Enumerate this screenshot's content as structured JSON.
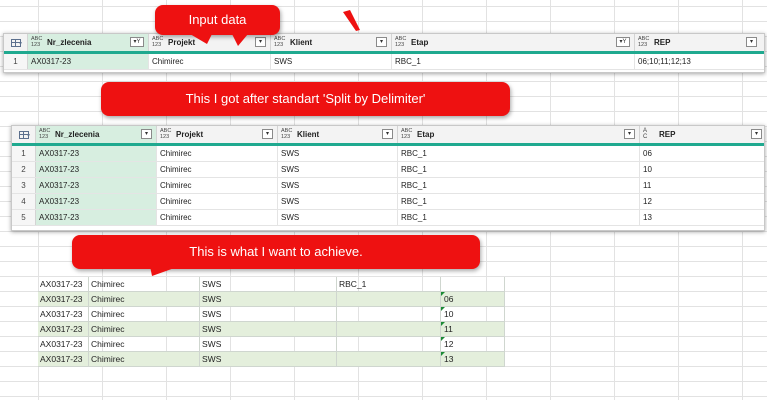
{
  "callouts": {
    "input": "Input data",
    "split": "This I got after standart 'Split by Delimiter'",
    "achieve": "This is what I want to achieve."
  },
  "type_icon": {
    "top": "ABC",
    "bottom": "123"
  },
  "input_grid": {
    "columns": [
      "Nr_zlecenia",
      "Projekt",
      "Klient",
      "Etap",
      "REP"
    ],
    "rows": [
      {
        "num": "1",
        "cells": [
          "AX0317-23",
          "Chimirec",
          "SWS",
          "RBC_1",
          "06;10;11;12;13"
        ]
      }
    ]
  },
  "split_grid": {
    "columns": [
      "Nr_zlecenia",
      "Projekt",
      "Klient",
      "Etap",
      "REP"
    ],
    "rep_type_icon": {
      "top": "A",
      "mid": "B",
      "bottom": "C"
    },
    "rows": [
      {
        "num": "1",
        "cells": [
          "AX0317-23",
          "Chimirec",
          "SWS",
          "RBC_1",
          "06"
        ]
      },
      {
        "num": "2",
        "cells": [
          "AX0317-23",
          "Chimirec",
          "SWS",
          "RBC_1",
          "10"
        ]
      },
      {
        "num": "3",
        "cells": [
          "AX0317-23",
          "Chimirec",
          "SWS",
          "RBC_1",
          "11"
        ]
      },
      {
        "num": "4",
        "cells": [
          "AX0317-23",
          "Chimirec",
          "SWS",
          "RBC_1",
          "12"
        ]
      },
      {
        "num": "5",
        "cells": [
          "AX0317-23",
          "Chimirec",
          "SWS",
          "RBC_1",
          "13"
        ]
      }
    ]
  },
  "target_sheet": {
    "rows": [
      [
        "AX0317-23",
        "Chimirec",
        "SWS",
        "RBC_1",
        ""
      ],
      [
        "AX0317-23",
        "Chimirec",
        "SWS",
        "",
        "06"
      ],
      [
        "AX0317-23",
        "Chimirec",
        "SWS",
        "",
        "10"
      ],
      [
        "AX0317-23",
        "Chimirec",
        "SWS",
        "",
        "11"
      ],
      [
        "AX0317-23",
        "Chimirec",
        "SWS",
        "",
        "12"
      ],
      [
        "AX0317-23",
        "Chimirec",
        "SWS",
        "",
        "13"
      ]
    ]
  },
  "colors": {
    "callout": "#ee1111",
    "teal_header": "#1fa98f",
    "first_col": "#d7eee0",
    "sheet_alt": "#e4efdc",
    "error_triangle": "#1a8a35"
  }
}
